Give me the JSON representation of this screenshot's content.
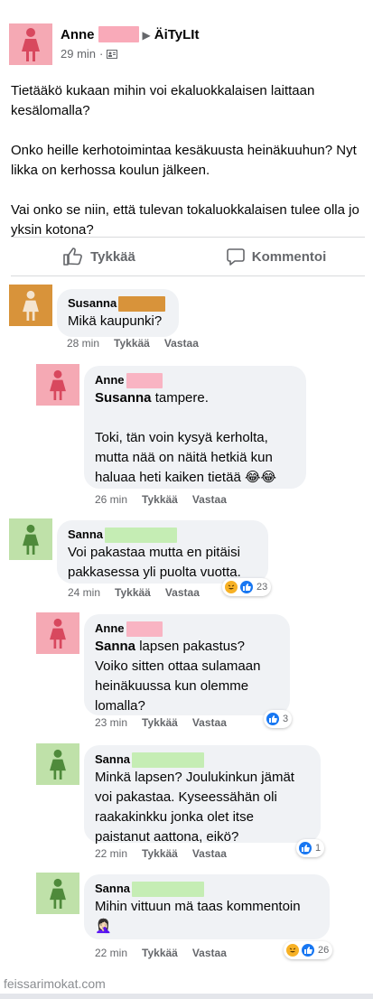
{
  "post": {
    "author": "Anne",
    "group": "ÄiTyLIt",
    "time": "29 min",
    "paragraphs": [
      "Tietääkö kukaan mihin voi ekaluokkalaisen laittaan kesälomalla?",
      "Onko heille kerhotoimintaa kesäkuusta heinäkuuhun? Nyt likka on kerhossa koulun jälkeen.",
      "Vai onko se niin, että tulevan tokaluokkalaisen tulee olla jo yksin kotona?"
    ]
  },
  "actions": {
    "like_label": "Tykkää",
    "comment_label": "Kommentoi"
  },
  "meta_labels": {
    "like": "Tykkää",
    "reply": "Vastaa"
  },
  "comments": [
    {
      "author": "Susanna",
      "text": "Mikä kaupunki?",
      "time": "28 min"
    },
    {
      "author": "Anne",
      "mention": "Susanna",
      "text": "tampere.",
      "text2": "Toki, tän voin kysyä kerholta, mutta nää on näitä hetkiä kun haluaa heti kaiken tietää",
      "emoji": "😂😂",
      "time": "26 min"
    },
    {
      "author": "Sanna",
      "text": "Voi pakastaa mutta en pitäisi pakkasessa yli puolta vuotta.",
      "time": "24 min",
      "reactions": "23"
    },
    {
      "author": "Anne",
      "mention": "Sanna",
      "text": "lapsen pakastus? Voiko sitten ottaa sulamaan heinäkuussa kun olemme lomalla?",
      "time": "23 min",
      "reactions": "3"
    },
    {
      "author": "Sanna",
      "text": "Minkä lapsen? Joulukinkun jämät voi pakastaa. Kyseessähän oli raakakinkku jonka olet itse paistanut aattona, eikö?",
      "time": "22 min",
      "reactions": "1"
    },
    {
      "author": "Sanna",
      "text": "Mihin vittuun mä taas kommentoin",
      "emoji": "🤦🏻‍♀️",
      "time": "22 min",
      "reactions": "26"
    }
  ],
  "colors": {
    "pink": "#f5a9b4",
    "tan": "#d8933a",
    "green": "#bfe1a9",
    "like_blue": "#1877f2",
    "haha_yellow": "#f7b125"
  },
  "icons": [
    "person-icon",
    "friends-audience-icon",
    "like-thumb-icon",
    "comment-icon",
    "like-reaction-icon",
    "haha-reaction-icon"
  ],
  "watermark": "feissarimokat.com"
}
